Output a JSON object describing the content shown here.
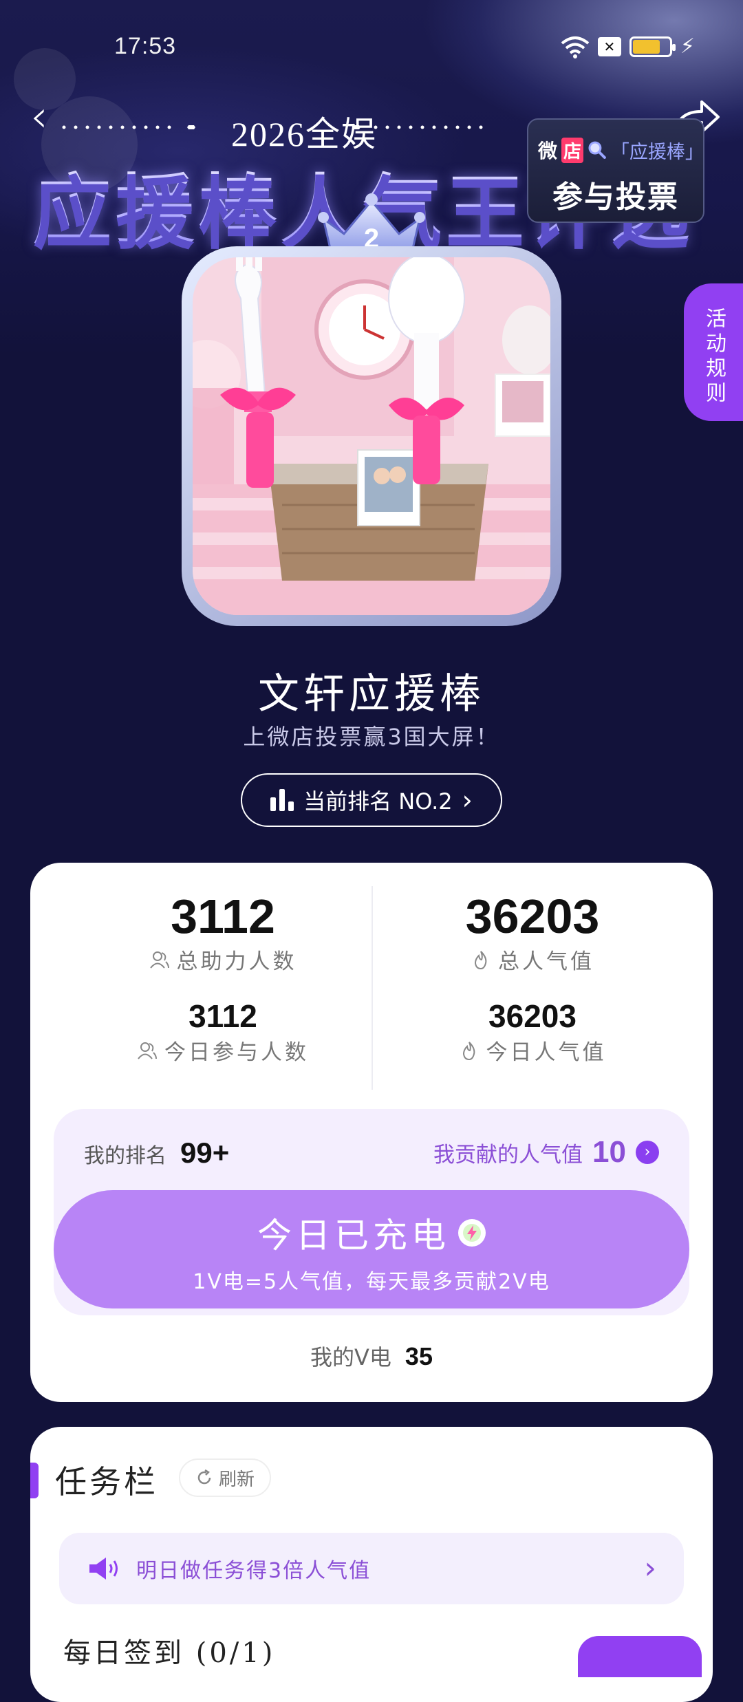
{
  "status_bar": {
    "time": "17:53"
  },
  "header": {
    "year_title": "2026全娱",
    "main_title": "应援棒人气王评选",
    "vote_box": {
      "brand_wei": "微",
      "brand_dian": "店",
      "keyword": "「应援棒」",
      "label": "参与投票"
    }
  },
  "side_tab": {
    "label": "活动规则"
  },
  "rank_badge": {
    "number": "2"
  },
  "candidate": {
    "name": "文轩应援棒",
    "slogan": "上微店投票赢3国大屏！",
    "rank_button": "当前排名 NO.2"
  },
  "stats": {
    "total_helpers": {
      "value": "3112",
      "label": "总助力人数"
    },
    "total_popularity": {
      "value": "36203",
      "label": "总人气值"
    },
    "today_participants": {
      "value": "3112",
      "label": "今日参与人数"
    },
    "today_popularity": {
      "value": "36203",
      "label": "今日人气值"
    }
  },
  "mine": {
    "rank_label": "我的排名",
    "rank_value": "99+",
    "contrib_label": "我贡献的人气值",
    "contrib_value": "10",
    "charge_title": "今日已充电",
    "charge_note": "1V电=5人气值，每天最多贡献2V电",
    "v_label": "我的V电",
    "v_value": "35"
  },
  "tasks": {
    "title": "任务栏",
    "refresh_label": "刷新",
    "notice": "明日做任务得3倍人气值",
    "daily_signin": "每日签到 (0/1)"
  },
  "colors": {
    "accent": "#9140f2",
    "button": "#b884f6",
    "bg": "#12123a"
  }
}
